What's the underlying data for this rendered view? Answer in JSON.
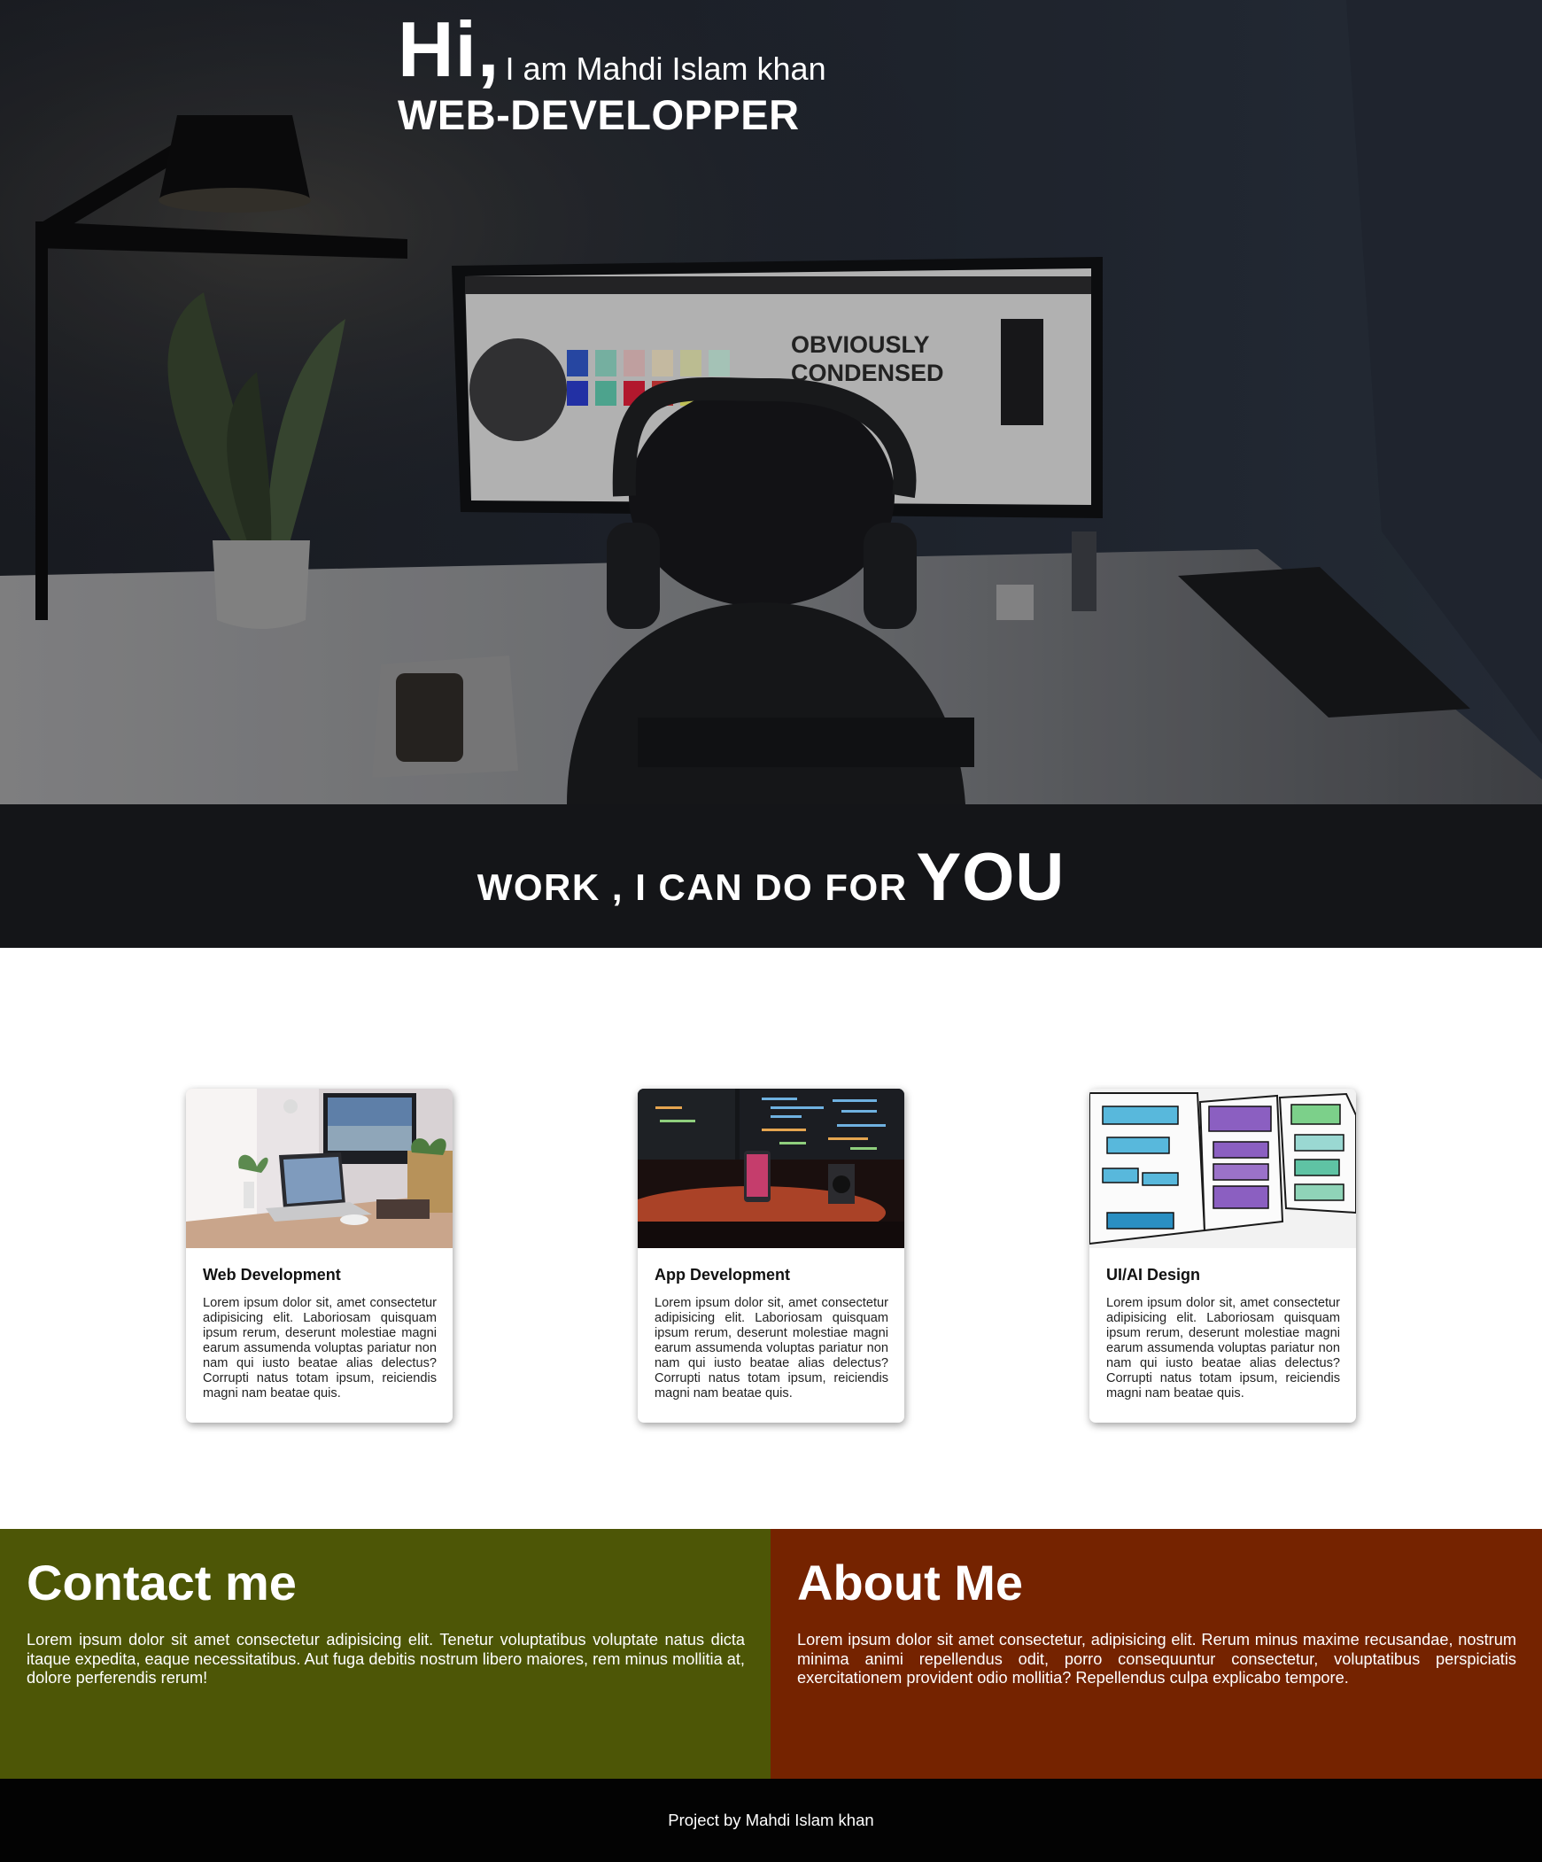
{
  "hero": {
    "greeting": "Hi,",
    "intro": "I am Mahdi Islam khan",
    "role": "WEB-DEVELOPPER",
    "screen_text": [
      "OBVIOUSLY",
      "CONDENSED"
    ]
  },
  "services": {
    "heading_small": "WORK , I CAN DO FOR",
    "heading_big": "YOU",
    "cards": [
      {
        "title": "Web Development",
        "image": "laptop-desk-image",
        "text": "Lorem ipsum dolor sit, amet consectetur adipisicing elit. Laboriosam quisquam ipsum rerum, deserunt molestiae magni earum assumenda voluptas pariatur non nam qui iusto beatae alias delectus? Corrupti natus totam ipsum, reiciendis magni nam beatae quis."
      },
      {
        "title": "App Development",
        "image": "code-screens-image",
        "text": "Lorem ipsum dolor sit, amet consectetur adipisicing elit. Laboriosam quisquam ipsum rerum, deserunt molestiae magni earum assumenda voluptas pariatur non nam qui iusto beatae alias delectus? Corrupti natus totam ipsum, reiciendis magni nam beatae quis."
      },
      {
        "title": "UI/AI Design",
        "image": "wireframe-sketch-image",
        "text": "Lorem ipsum dolor sit, amet consectetur adipisicing elit. Laboriosam quisquam ipsum rerum, deserunt molestiae magni earum assumenda voluptas pariatur non nam qui iusto beatae alias delectus? Corrupti natus totam ipsum, reiciendis magni nam beatae quis."
      }
    ]
  },
  "contact": {
    "title": "Contact me",
    "text": "Lorem ipsum dolor sit amet consectetur adipisicing elit. Tenetur voluptatibus voluptate natus dicta itaque expedita, eaque necessitatibus. Aut fuga debitis nostrum libero maiores, rem minus mollitia at, dolore perferendis rerum!"
  },
  "about": {
    "title": "About Me",
    "text": "Lorem ipsum dolor sit amet consectetur, adipisicing elit. Rerum minus maxime recusandae, nostrum minima animi repellendus odit, porro consequuntur consectetur, voluptatibus perspiciatis exercitationem provident odio mollitia? Repellendus culpa explicabo tempore."
  },
  "footer": {
    "text": "Project by Mahdi Islam khan"
  },
  "colors": {
    "hero_bg": "#1b1f27",
    "banner_bg": "#141518",
    "contact_bg": "#4d5606",
    "about_bg": "#752300",
    "footer_bg": "#030303"
  }
}
